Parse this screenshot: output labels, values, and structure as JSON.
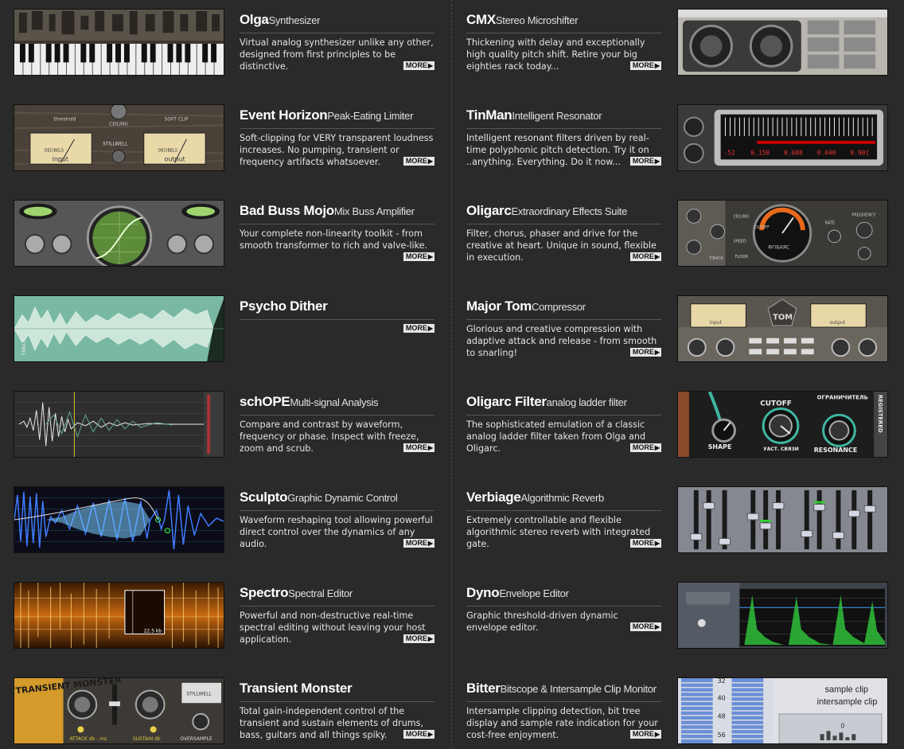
{
  "more_label": "MORE",
  "products": [
    {
      "name": "Olga",
      "subtitle": "Synthesizer",
      "desc": "Virtual analog synthesizer unlike any other, designed from first principles to be distinctive.",
      "thumb": "keyboard-thumb",
      "side": "left",
      "row": 0
    },
    {
      "name": "CMX",
      "subtitle": "Stereo Microshifter",
      "desc": "Thickening with delay and exceptionally high quality pitch shift. Retire your big eighties rack today...",
      "thumb": "knobs-panel-thumb",
      "side": "right",
      "row": 0
    },
    {
      "name": "Event Horizon",
      "subtitle": "Peak-Eating Limiter",
      "desc": "Soft-clipping for VERY transparent loudness increases. No pumping, transient or frequency artifacts whatsoever.",
      "thumb": "vu-meters-thumb",
      "side": "left",
      "row": 1
    },
    {
      "name": "TinMan",
      "subtitle": "Intelligent Resonator",
      "desc": "Intelligent resonant filters driven by real-time polyphonic pitch detection. Try it on ..anything. Everything. Do it now...",
      "thumb": "resonator-display-thumb",
      "side": "right",
      "row": 1
    },
    {
      "name": "Bad Buss Mojo",
      "subtitle": "Mix Buss Amplifier",
      "desc": "Your complete non-linearity toolkit - from smooth transformer to rich and valve-like.",
      "thumb": "oscilloscope-thumb",
      "side": "left",
      "row": 2
    },
    {
      "name": "Oligarc",
      "subtitle": "Extraordinary Effects Suite",
      "desc": "Filter, chorus, phaser and drive for the creative at heart. Unique in sound, flexible in execution.",
      "thumb": "effects-dial-thumb",
      "side": "right",
      "row": 2
    },
    {
      "name": "Psycho Dither",
      "subtitle": "",
      "desc": "",
      "thumb": "dither-waveform-thumb",
      "side": "left",
      "row": 3
    },
    {
      "name": "Major Tom",
      "subtitle": "Compressor",
      "desc": "Glorious and creative compression with adaptive attack and release - from smooth to snarling!",
      "thumb": "compressor-thumb",
      "side": "right",
      "row": 3
    },
    {
      "name": "schOPE",
      "subtitle": "Multi-signal Analysis",
      "desc": "Compare and contrast by waveform, frequency or phase. Inspect with freeze, zoom and scrub.",
      "thumb": "analysis-scope-thumb",
      "side": "left",
      "row": 4
    },
    {
      "name": "Oligarc Filter",
      "subtitle": "analog ladder filter",
      "desc": "The sophisticated emulation of a classic analog ladder filter taken from Olga and Oligarc.",
      "thumb": "ladder-filter-thumb",
      "side": "right",
      "row": 4
    },
    {
      "name": "Sculpto",
      "subtitle": "Graphic Dynamic Control",
      "desc": "Waveform reshaping tool allowing powerful direct control over the dynamics of any audio.",
      "thumb": "dynamics-waveform-thumb",
      "side": "left",
      "row": 5
    },
    {
      "name": "Verbiage",
      "subtitle": "Algorithmic Reverb",
      "desc": "Extremely controllable and flexible algorithmic stereo reverb with integrated gate.",
      "thumb": "faders-thumb",
      "side": "right",
      "row": 5
    },
    {
      "name": "Spectro",
      "subtitle": "Spectral Editor",
      "desc": "Powerful and non-destructive real-time spectral editing without leaving your host application.",
      "thumb": "spectrogram-thumb",
      "side": "left",
      "row": 6
    },
    {
      "name": "Dyno",
      "subtitle": "Envelope Editor",
      "desc": "Graphic threshold-driven dynamic envelope editor.",
      "thumb": "envelope-thumb",
      "side": "right",
      "row": 6
    },
    {
      "name": "Transient Monster",
      "subtitle": "",
      "desc": "Total gain-independent control of the transient and sustain elements of drums, bass, guitars and all things spiky.",
      "thumb": "transient-thumb",
      "side": "left",
      "row": 7
    },
    {
      "name": "Bitter",
      "subtitle": "Bitscope & Intersample Clip Monitor",
      "desc": "Intersample clipping detection, bit tree display and sample rate indication for your cost-free enjoyment.",
      "thumb": "bitscope-thumb",
      "side": "right",
      "row": 7
    }
  ],
  "thumb_text": {
    "limiter_threshold": "threshold",
    "limiter_ceiling": "CEILING",
    "limiter_soft_clip": "SOFT CLIP",
    "limiter_decibels": "DECIBELS",
    "limiter_input": "input",
    "limiter_output": "output",
    "brand": "STILLWELL",
    "tinman_readouts": [
      "-52",
      "0.150",
      "0.688",
      "0.040",
      "0.901"
    ],
    "dial_brand": "ФГІБАЯС",
    "dial_ceiling": "CEILING",
    "dial_cutoff": "CUTOFF",
    "dial_speed": "SPEED",
    "dial_floor": "FLOOR",
    "dial_rate": "RATE",
    "dial_frequency": "FREQUENCY",
    "dial_fback": "F.BACK",
    "dither_label": "TRAILS",
    "comp_label": "TOM",
    "comp_input": "input",
    "comp_output": "output",
    "filter_cutoff": "CUTOFF",
    "filter_limiter": "ОГРАНИЧИТЕЛЬ",
    "filter_shape": "SHAPE",
    "filter_resonance": "RESONANCE",
    "filter_registered": "REGISTERED",
    "filter_drive": "УАСТ. СВЯЗИ",
    "transient_title": "TRANSIENT MONSTER",
    "transient_attack": "ATTACK db - ms",
    "transient_sustain": "SUSTAIN db",
    "transient_oversample": "OVERSAMPLE",
    "bitter_sample_clip": "sample clip",
    "bitter_intersample_clip": "intersample clip",
    "bitter_scale": [
      "32",
      "40",
      "48",
      "56"
    ],
    "bitter_zero": "0",
    "spectro_readout": "22.5 kb"
  }
}
